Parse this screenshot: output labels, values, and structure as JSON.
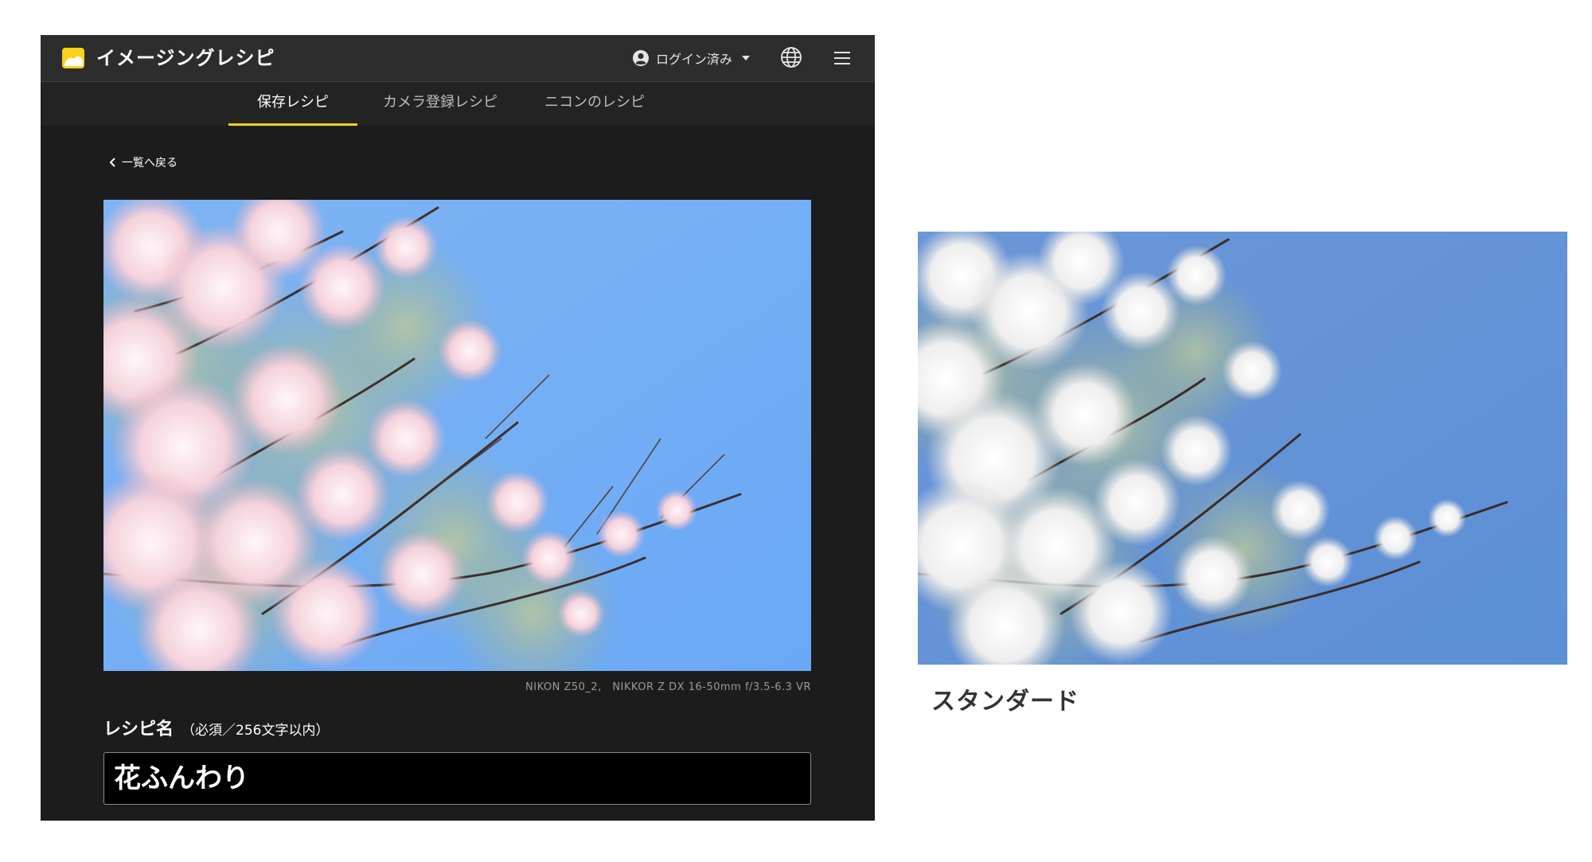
{
  "app": {
    "title": "イメージングレシピ",
    "account_label": "ログイン済み",
    "brand_color": "#f2d31b"
  },
  "tabs": [
    {
      "label": "保存レシピ",
      "active": true
    },
    {
      "label": "カメラ登録レシピ",
      "active": false
    },
    {
      "label": "ニコンのレシピ",
      "active": false
    }
  ],
  "back_link": "一覧へ戻る",
  "photo": {
    "caption": "NIKON Z50_2,　NIKKOR Z DX 16-50mm f/3.5-6.3 VR"
  },
  "recipe": {
    "label": "レシピ名",
    "note": "（必須／256文字以内）",
    "value": "花ふんわり"
  },
  "comparison": {
    "caption": "スタンダード"
  },
  "icons": {
    "logo": "imaging-recipe-logo",
    "account": "account-circle-icon",
    "dropdown": "caret-down-icon",
    "language": "globe-icon",
    "menu": "hamburger-menu-icon",
    "back": "chevron-left-icon"
  }
}
